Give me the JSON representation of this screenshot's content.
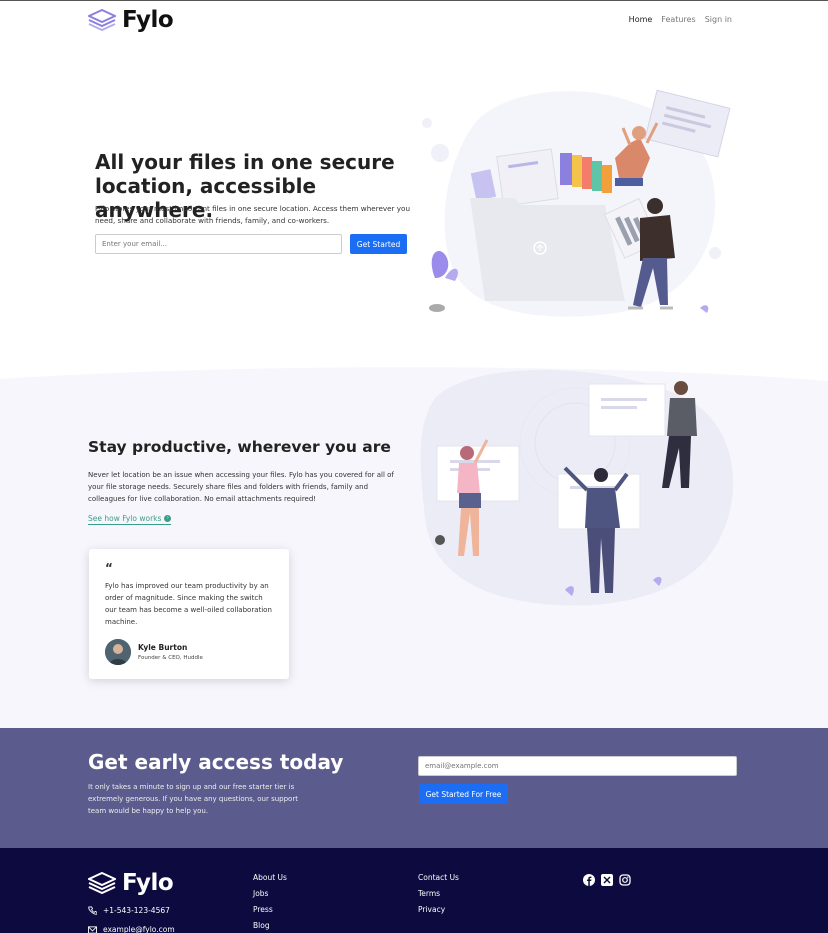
{
  "brand": {
    "name": "Fylo"
  },
  "nav": {
    "links": [
      "Home",
      "Features",
      "Sign in"
    ]
  },
  "hero": {
    "title": "All your files in one secure location, accessible anywhere.",
    "text": "Fylo stores your most important files in one secure location. Access them wherever you need, share and collaborate with friends, family, and co-workers.",
    "input_placeholder": "Enter your email...",
    "button": "Get Started"
  },
  "productive": {
    "title": "Stay productive, wherever you are",
    "text": "Never let location be an issue when accessing your files. Fylo has you covered for all of your file storage needs. Securely share files and folders with friends, family and colleagues for live collaboration. No email attachments required!",
    "link": "See how Fylo works"
  },
  "testimonial": {
    "quote_mark": "“",
    "text": "Fylo has improved our team productivity by an order of magnitude. Since making the switch our team has become a well-oiled collaboration machine.",
    "name": "Kyle Burton",
    "role": "Founder & CEO, Huddle"
  },
  "cta": {
    "title": "Get early access today",
    "text": "It only takes a minute to sign up and our free starter tier is extremely generous. If you have any questions, our support team would be happy to help you.",
    "input_placeholder": "email@example.com",
    "button": "Get Started For Free"
  },
  "footer": {
    "phone": "+1-543-123-4567",
    "email": "example@fylo.com",
    "col1": [
      "About Us",
      "Jobs",
      "Press",
      "Blog"
    ],
    "col2": [
      "Contact Us",
      "Terms",
      "Privacy"
    ],
    "social": [
      "facebook-icon",
      "x-icon",
      "instagram-icon"
    ]
  },
  "colors": {
    "primary": "#1b6ef3",
    "cta_bg": "#5c5b8e",
    "footer_bg": "#0c0a3e",
    "link": "#3a9d8a"
  }
}
